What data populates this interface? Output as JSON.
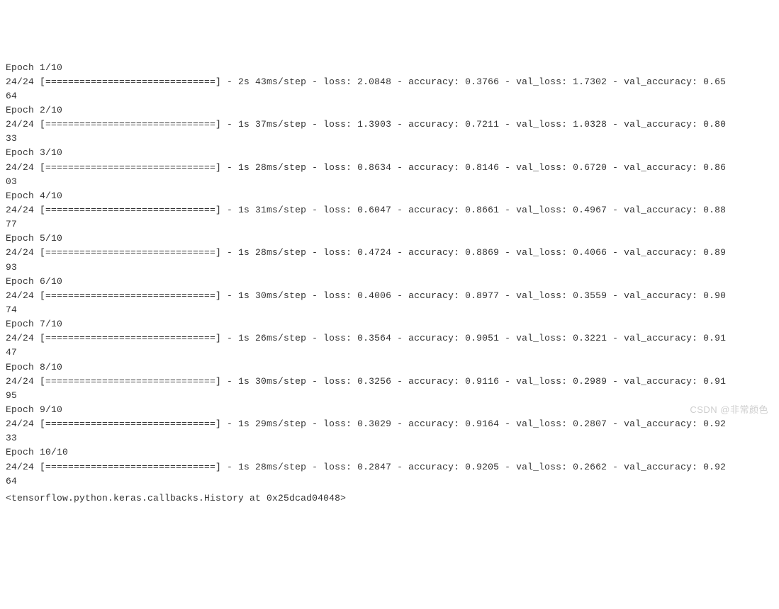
{
  "training": {
    "total_epochs": 10,
    "steps_per_epoch": 24,
    "progress_bar": "[==============================]",
    "epochs": [
      {
        "epoch_label": "Epoch 1/10",
        "steps": "24/24",
        "time": "2s",
        "per_step": "43ms/step",
        "loss": "2.0848",
        "accuracy": "0.3766",
        "val_loss": "1.7302",
        "val_accuracy_p1": "0.65",
        "val_accuracy_p2": "64"
      },
      {
        "epoch_label": "Epoch 2/10",
        "steps": "24/24",
        "time": "1s",
        "per_step": "37ms/step",
        "loss": "1.3903",
        "accuracy": "0.7211",
        "val_loss": "1.0328",
        "val_accuracy_p1": "0.80",
        "val_accuracy_p2": "33"
      },
      {
        "epoch_label": "Epoch 3/10",
        "steps": "24/24",
        "time": "1s",
        "per_step": "28ms/step",
        "loss": "0.8634",
        "accuracy": "0.8146",
        "val_loss": "0.6720",
        "val_accuracy_p1": "0.86",
        "val_accuracy_p2": "03"
      },
      {
        "epoch_label": "Epoch 4/10",
        "steps": "24/24",
        "time": "1s",
        "per_step": "31ms/step",
        "loss": "0.6047",
        "accuracy": "0.8661",
        "val_loss": "0.4967",
        "val_accuracy_p1": "0.88",
        "val_accuracy_p2": "77"
      },
      {
        "epoch_label": "Epoch 5/10",
        "steps": "24/24",
        "time": "1s",
        "per_step": "28ms/step",
        "loss": "0.4724",
        "accuracy": "0.8869",
        "val_loss": "0.4066",
        "val_accuracy_p1": "0.89",
        "val_accuracy_p2": "93"
      },
      {
        "epoch_label": "Epoch 6/10",
        "steps": "24/24",
        "time": "1s",
        "per_step": "30ms/step",
        "loss": "0.4006",
        "accuracy": "0.8977",
        "val_loss": "0.3559",
        "val_accuracy_p1": "0.90",
        "val_accuracy_p2": "74"
      },
      {
        "epoch_label": "Epoch 7/10",
        "steps": "24/24",
        "time": "1s",
        "per_step": "26ms/step",
        "loss": "0.3564",
        "accuracy": "0.9051",
        "val_loss": "0.3221",
        "val_accuracy_p1": "0.91",
        "val_accuracy_p2": "47"
      },
      {
        "epoch_label": "Epoch 8/10",
        "steps": "24/24",
        "time": "1s",
        "per_step": "30ms/step",
        "loss": "0.3256",
        "accuracy": "0.9116",
        "val_loss": "0.2989",
        "val_accuracy_p1": "0.91",
        "val_accuracy_p2": "95"
      },
      {
        "epoch_label": "Epoch 9/10",
        "steps": "24/24",
        "time": "1s",
        "per_step": "29ms/step",
        "loss": "0.3029",
        "accuracy": "0.9164",
        "val_loss": "0.2807",
        "val_accuracy_p1": "0.92",
        "val_accuracy_p2": "33"
      },
      {
        "epoch_label": "Epoch 10/10",
        "steps": "24/24",
        "time": "1s",
        "per_step": "28ms/step",
        "loss": "0.2847",
        "accuracy": "0.9205",
        "val_loss": "0.2662",
        "val_accuracy_p1": "0.92",
        "val_accuracy_p2": "64"
      }
    ],
    "history_repr": "<tensorflow.python.keras.callbacks.History at 0x25dcad04048>"
  },
  "watermark_text": "CSDN @非常颜色"
}
